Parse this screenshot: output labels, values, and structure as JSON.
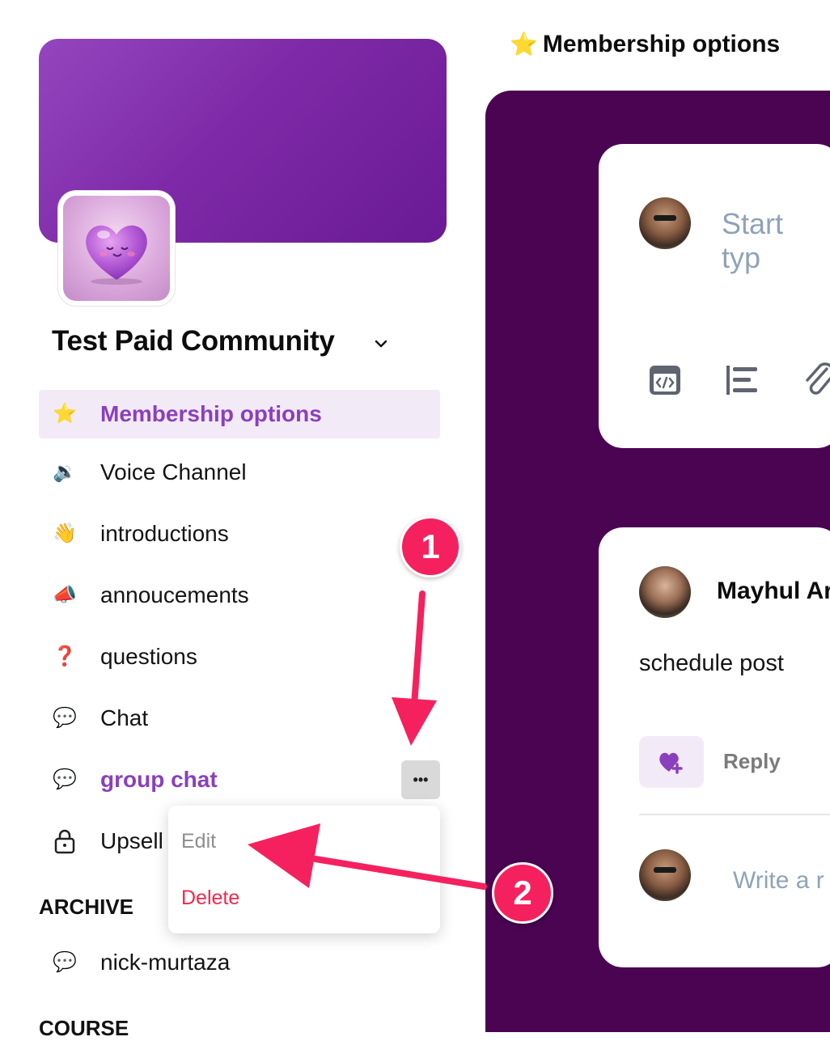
{
  "community": {
    "name": "Test Paid Community"
  },
  "sidebar": {
    "items": [
      {
        "icon": "⭐",
        "icon_name": "star-icon",
        "label": "Membership options",
        "state": "active"
      },
      {
        "icon": "🔉",
        "icon_name": "speaker-icon",
        "label": "Voice Channel"
      },
      {
        "icon": "👋",
        "icon_name": "waving-hand-icon",
        "label": "introductions"
      },
      {
        "icon": "📣",
        "icon_name": "megaphone-icon",
        "label": "annoucements"
      },
      {
        "icon": "❓",
        "icon_name": "question-mark-icon",
        "label": "questions"
      },
      {
        "icon": "💬",
        "icon_name": "speech-bubble-icon",
        "label": "Chat"
      },
      {
        "icon": "💬",
        "icon_name": "speech-bubble-icon",
        "label": "group chat",
        "state": "highlighted"
      },
      {
        "icon_name": "lock-icon",
        "label": "Upsell"
      }
    ],
    "archive_heading": "ARCHIVE",
    "archive_items": [
      {
        "icon": "💬",
        "icon_name": "speech-bubble-icon",
        "label": "nick-murtaza"
      }
    ],
    "course_heading": "COURSE",
    "more_button": "•••"
  },
  "context_menu": {
    "edit": "Edit",
    "delete": "Delete"
  },
  "annotations": {
    "step1": "1",
    "step2": "2"
  },
  "channel": {
    "title": "Membership options",
    "title_icon": "⭐"
  },
  "composer": {
    "placeholder": "Start typ"
  },
  "post": {
    "author": "Mayhul Ar",
    "text": "schedule post",
    "reply_label": "Reply",
    "reply_placeholder": "Write a r"
  },
  "colors": {
    "accent": "#8a3fbd",
    "main_panel": "#4a0452",
    "annotation": "#f5215e",
    "delete": "#f0284f"
  }
}
